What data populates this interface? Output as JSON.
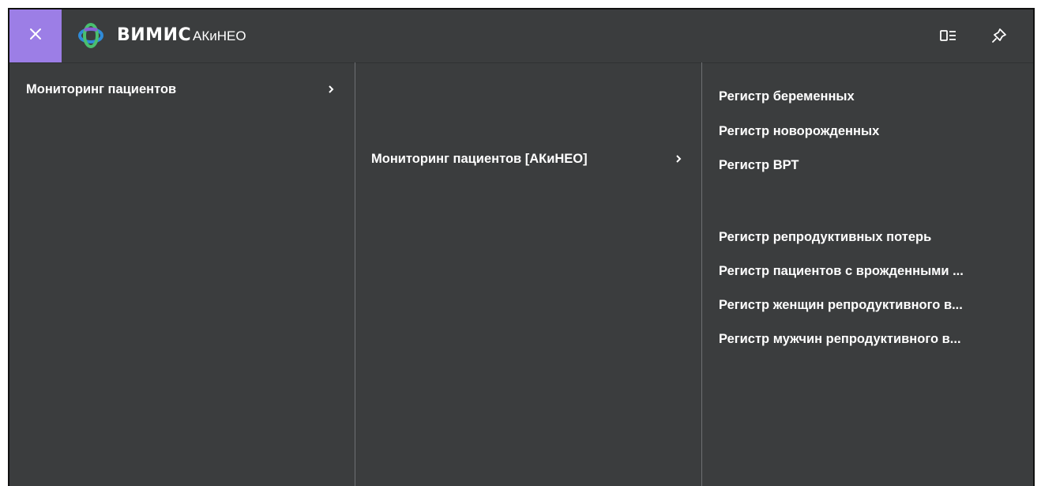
{
  "header": {
    "brand": "ВИМИС",
    "product": "АКиНЕО",
    "icons": [
      "close-icon",
      "logo-icon",
      "layout-list-icon",
      "pin-icon"
    ],
    "accent_color": "#9c7ee6",
    "logo_colors": [
      "#2f8bd8",
      "#49c06f",
      "#8a5fd6"
    ]
  },
  "menu": {
    "level1": [
      {
        "label": "Мониторинг пациентов",
        "has_submenu": true
      }
    ],
    "level2": [
      {
        "label": "Мониторинг пациентов [АКиНЕО]",
        "has_submenu": true
      }
    ],
    "level3": [
      {
        "label": "Регистр беременных"
      },
      {
        "label": "Регистр новорожденных"
      },
      {
        "label": "Регистр ВРТ"
      },
      {
        "label": "Регистр репродуктивных потерь"
      },
      {
        "label": "Регистр пациентов с врожденными ..."
      },
      {
        "label": "Регистр женщин репродуктивного в..."
      },
      {
        "label": "Регистр мужчин репродуктивного в..."
      }
    ]
  }
}
